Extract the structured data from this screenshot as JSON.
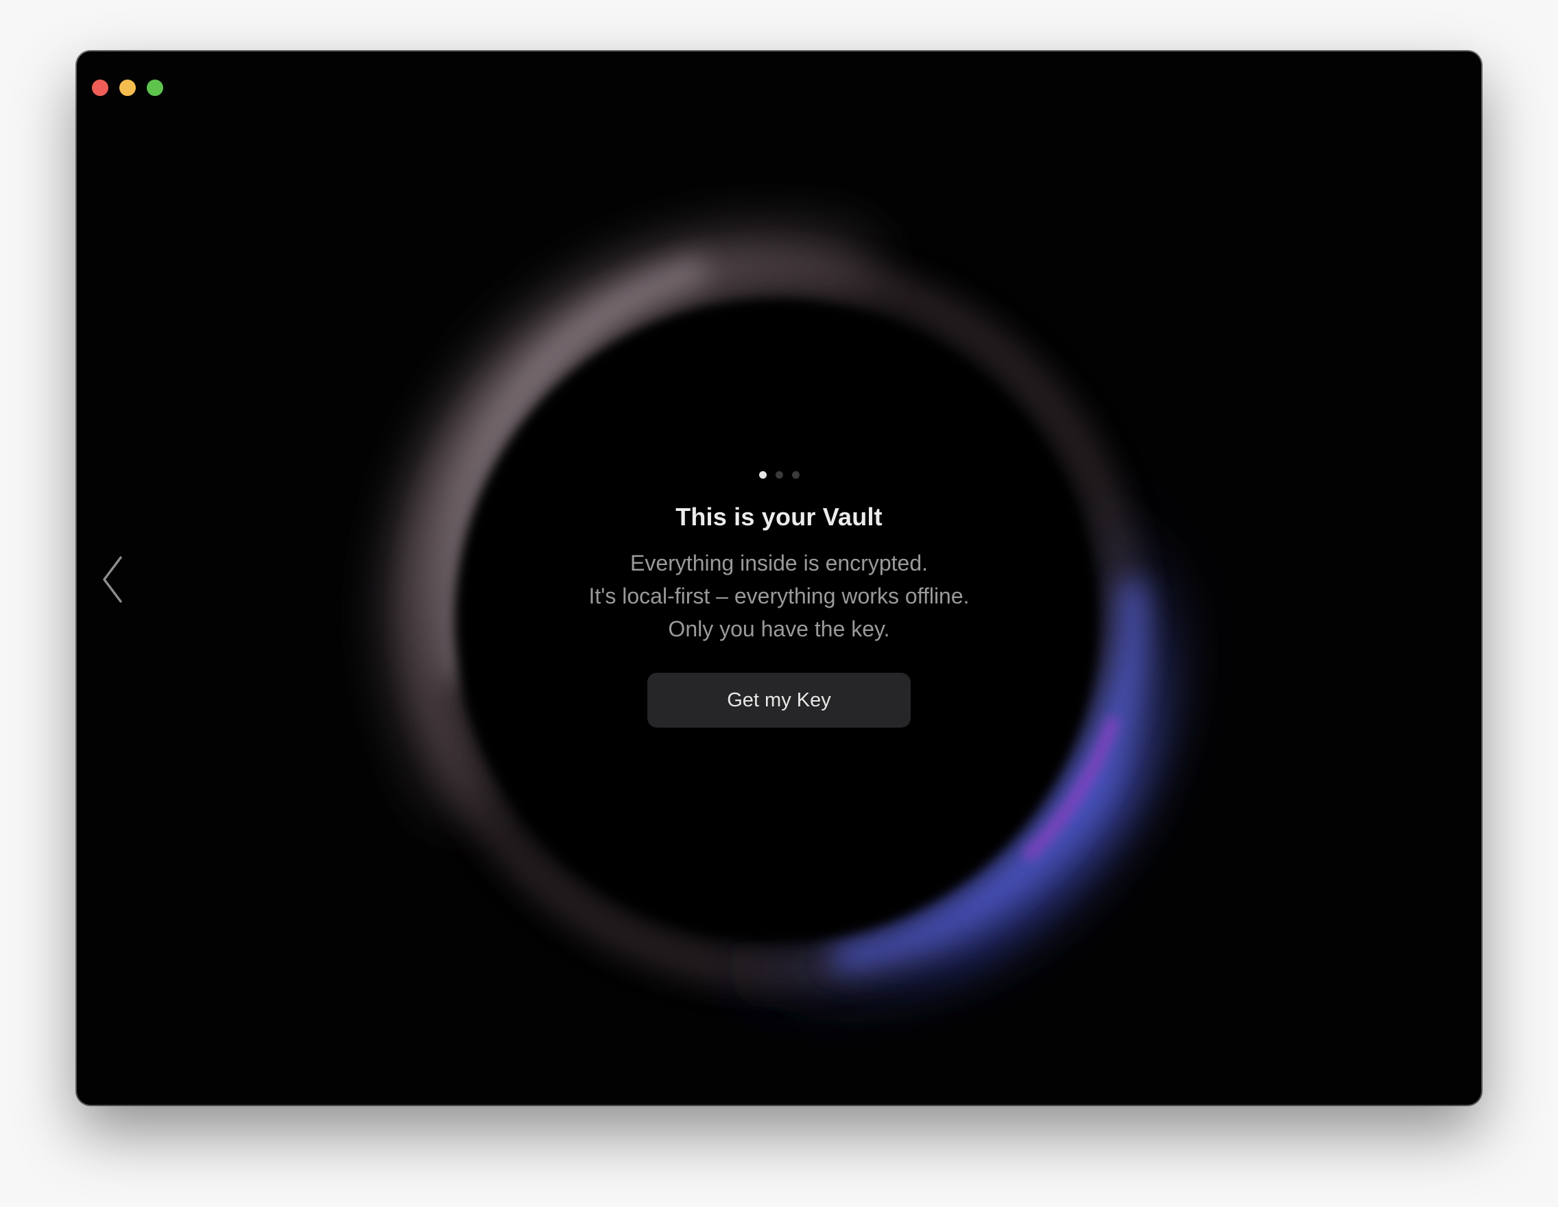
{
  "window": {
    "controls": {
      "close_color": "#ee5e56",
      "minimize_color": "#f5bd4f",
      "maximize_color": "#5ec44e"
    }
  },
  "navigation": {
    "back_icon": "chevron-left-icon"
  },
  "pager": {
    "total": 3,
    "active_index": 0
  },
  "onboarding": {
    "title": "This is your Vault",
    "lines": [
      "Everything inside is encrypted.",
      "It's local-first – everything works offline.",
      "Only you have the key."
    ],
    "cta_label": "Get my Key"
  },
  "theme": {
    "background": "#020203",
    "ring_warm": "#8a7a80",
    "ring_cool": "#4a56c8",
    "ring_accent": "#8a3fc0"
  }
}
